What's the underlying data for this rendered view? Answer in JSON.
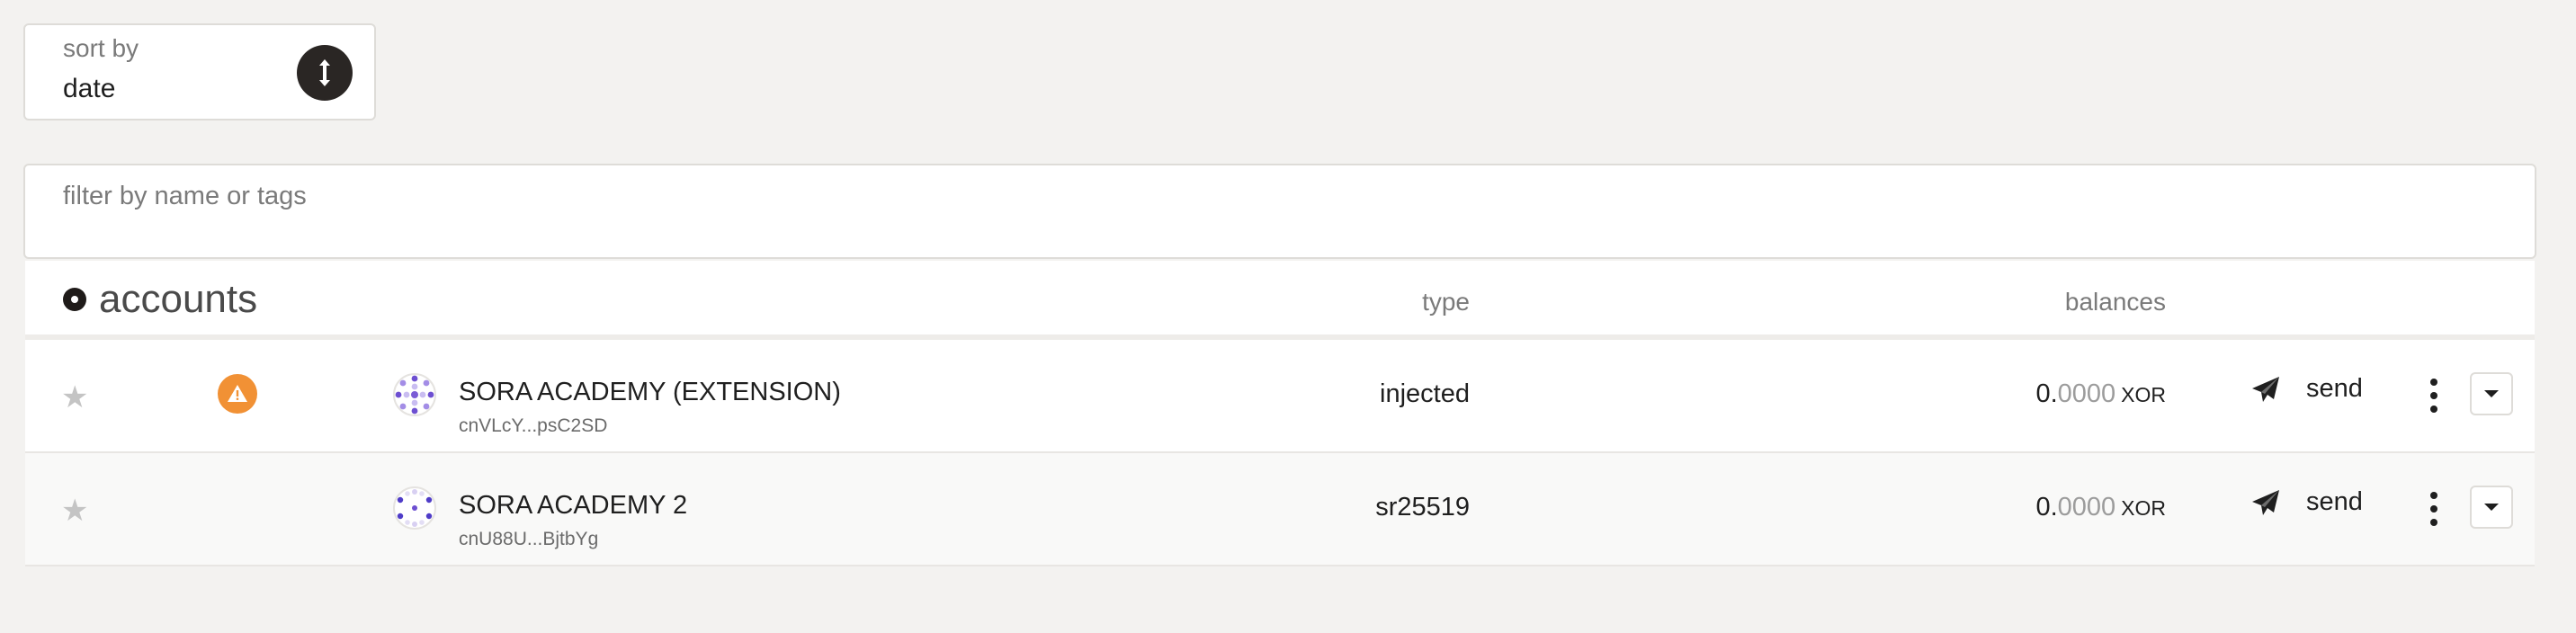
{
  "sort": {
    "label": "sort by",
    "value": "date"
  },
  "filter": {
    "placeholder": "filter by name or tags",
    "value": ""
  },
  "table": {
    "title": "accounts",
    "columns": {
      "type": "type",
      "balances": "balances"
    },
    "rows": [
      {
        "name": "SORA ACADEMY (EXTENSION)",
        "address": "cnVLcY...psC2SD",
        "type": "injected",
        "balance_int": "0.",
        "balance_dec": "0000",
        "unit": "XOR",
        "send_label": "send",
        "has_warning": true
      },
      {
        "name": "SORA ACADEMY 2",
        "address": "cnU88U...BjtbYg",
        "type": "sr25519",
        "balance_int": "0.",
        "balance_dec": "0000",
        "unit": "XOR",
        "send_label": "send",
        "has_warning": false
      }
    ]
  },
  "colors": {
    "background": "#f3f2f0",
    "warning": "#f19135",
    "dark_button": "#2a2624",
    "avatar_purple": "#7b5cd6"
  },
  "icons": {
    "sort": "sort-vertical-arrows-icon",
    "star": "star-icon",
    "warning": "warning-triangle-icon",
    "send": "paper-plane-icon",
    "menu": "kebab-menu-icon",
    "expand": "caret-down-icon"
  }
}
